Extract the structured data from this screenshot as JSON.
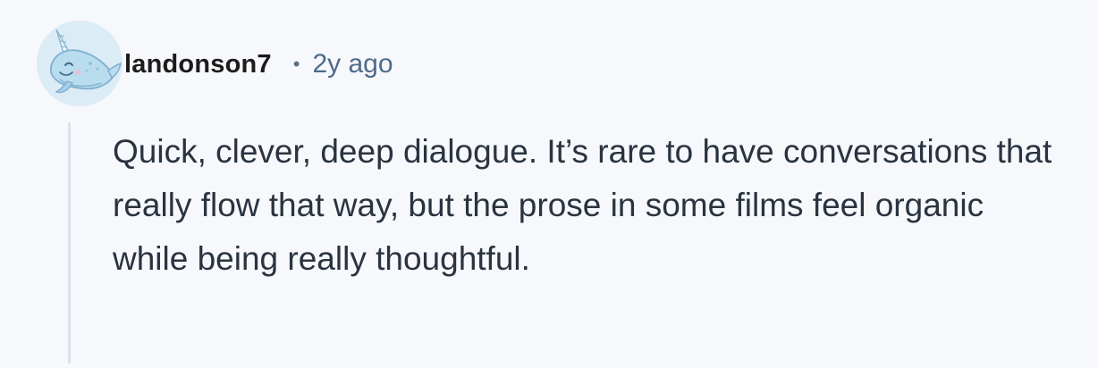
{
  "comment": {
    "author": "landonson7",
    "separator": "•",
    "time_ago": "2y ago",
    "avatar_icon": "narwhal-avatar-icon",
    "text": "Quick, clever, deep dialogue. It’s rare to have conversations that really flow that way, but the prose in some films feel organic while being really thoughtful."
  },
  "colors": {
    "background": "#f7f8fc",
    "avatar_background": "#dcecf6",
    "username": "#1c1c1c",
    "timestamp": "#4f6a8a",
    "body_text": "#2a3440",
    "thread_line": "#dbe2ec"
  }
}
